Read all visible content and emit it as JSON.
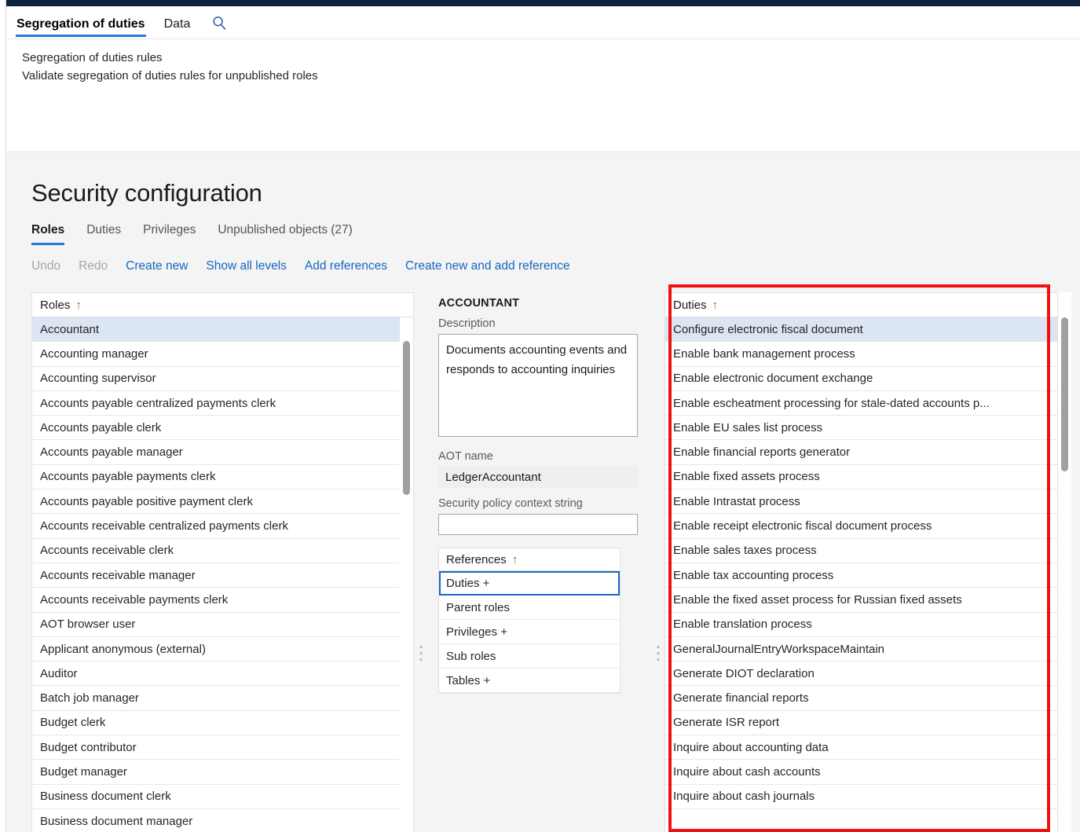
{
  "window": {
    "accent_color": "#2b77d4",
    "header_bar_color": "#0c2340",
    "highlight_box_color": "#ee1111",
    "selected_row_color": "#dce5f3"
  },
  "actionpane": {
    "tabs": [
      {
        "label": "Segregation of duties",
        "active": true
      },
      {
        "label": "Data",
        "active": false
      }
    ],
    "search_icon": "search-icon",
    "buttons": [
      {
        "label": "Segregation of duties rules"
      },
      {
        "label": "Validate segregation of duties rules for unpublished roles"
      }
    ]
  },
  "page": {
    "title": "Security configuration",
    "tabs": [
      {
        "label": "Roles",
        "active": true
      },
      {
        "label": "Duties",
        "active": false
      },
      {
        "label": "Privileges",
        "active": false
      },
      {
        "label": "Unpublished objects (27)",
        "active": false
      }
    ],
    "toolbar": [
      {
        "label": "Undo",
        "disabled": true
      },
      {
        "label": "Redo",
        "disabled": true
      },
      {
        "label": "Create new",
        "disabled": false
      },
      {
        "label": "Show all levels",
        "disabled": false
      },
      {
        "label": "Add references",
        "disabled": false
      },
      {
        "label": "Create new and add reference",
        "disabled": false
      }
    ]
  },
  "roles_grid": {
    "header": "Roles",
    "sort_indicator": "↑",
    "selected_index": 0,
    "rows": [
      "Accountant",
      "Accounting manager",
      "Accounting supervisor",
      "Accounts payable centralized payments clerk",
      "Accounts payable clerk",
      "Accounts payable manager",
      "Accounts payable payments clerk",
      "Accounts payable positive payment clerk",
      "Accounts receivable centralized payments clerk",
      "Accounts receivable clerk",
      "Accounts receivable manager",
      "Accounts receivable payments clerk",
      "AOT browser user",
      "Applicant anonymous (external)",
      "Auditor",
      "Batch job manager",
      "Budget clerk",
      "Budget contributor",
      "Budget manager",
      "Business document clerk",
      "Business document manager"
    ]
  },
  "detail": {
    "title": "ACCOUNTANT",
    "description_label": "Description",
    "description_value": "Documents accounting events and responds to accounting inquiries",
    "aot_name_label": "AOT name",
    "aot_name_value": "LedgerAccountant",
    "policy_label": "Security policy context string",
    "policy_value": "",
    "policy_placeholder": "",
    "references": {
      "header": "References",
      "sort_indicator": "↑",
      "focused_index": 0,
      "rows": [
        "Duties +",
        "Parent roles",
        "Privileges +",
        "Sub roles",
        "Tables +"
      ]
    }
  },
  "duties_grid": {
    "header": "Duties",
    "sort_indicator": "↑",
    "selected_index": 0,
    "rows": [
      "Configure electronic fiscal document",
      "Enable bank management process",
      "Enable electronic document exchange",
      "Enable escheatment processing for stale-dated accounts p...",
      "Enable EU sales list process",
      "Enable financial reports generator",
      "Enable fixed assets process",
      "Enable Intrastat process",
      "Enable receipt electronic fiscal document process",
      "Enable sales taxes process",
      "Enable tax accounting process",
      "Enable the fixed asset process for Russian fixed assets",
      "Enable translation process",
      "GeneralJournalEntryWorkspaceMaintain",
      "Generate DIOT declaration",
      "Generate financial reports",
      "Generate ISR report",
      "Inquire about accounting data",
      "Inquire about cash accounts",
      "Inquire about cash journals",
      ""
    ]
  }
}
